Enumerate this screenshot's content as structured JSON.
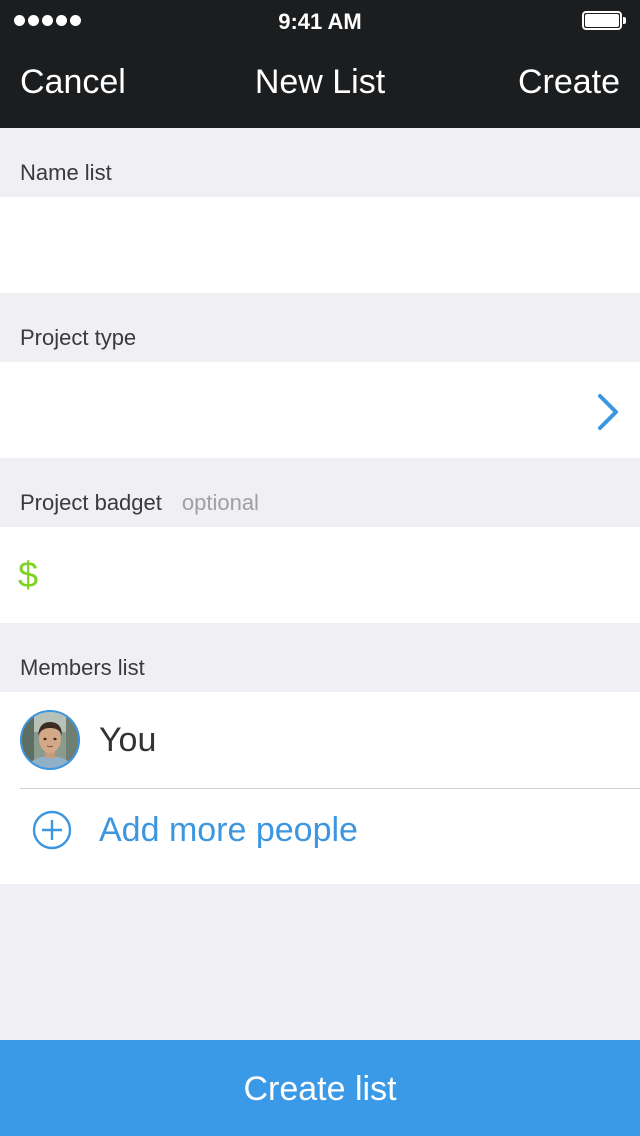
{
  "status_bar": {
    "time": "9:41 AM",
    "signal_icon": "signal-dots-icon",
    "battery_icon": "battery-icon"
  },
  "nav": {
    "cancel_label": "Cancel",
    "title": "New List",
    "create_label": "Create"
  },
  "name_list": {
    "label": "Name list",
    "value": ""
  },
  "project_type": {
    "label": "Project type",
    "value": "",
    "icon": "chevron-right-icon"
  },
  "project_budget": {
    "label": "Project badget",
    "optional_label": "optional",
    "currency_symbol": "$",
    "value": ""
  },
  "members": {
    "label": "Members list",
    "items": [
      {
        "name": "You",
        "avatar_icon": "user-avatar"
      }
    ],
    "add_label": "Add more people",
    "add_icon": "plus-circle-icon"
  },
  "footer": {
    "create_list_label": "Create list"
  },
  "colors": {
    "header_bg": "#1b1d1f",
    "page_bg": "#efeff4",
    "accent_blue": "#3c96e0",
    "button_blue": "#3b9ae8",
    "currency_green": "#7ed321"
  }
}
